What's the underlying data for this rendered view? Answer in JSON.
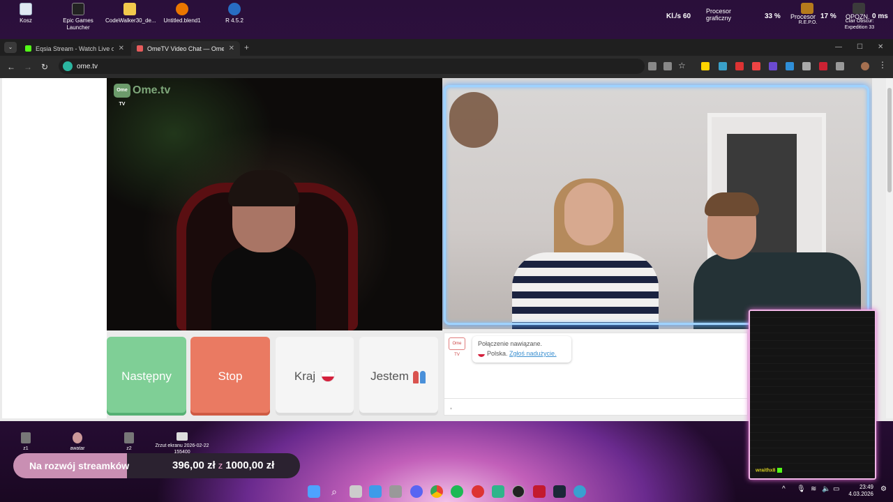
{
  "desktop": {
    "icons": [
      {
        "label": "Kosz",
        "icon": "recycle-bin-icon"
      },
      {
        "label": "Epic Games Launcher",
        "icon": "epic-games-icon"
      },
      {
        "label": "CodeWalker30_de...",
        "icon": "folder-icon"
      },
      {
        "label": "Untitled.blend1",
        "icon": "blender-icon"
      },
      {
        "label": "R 4.5.2",
        "icon": "r-lang-icon"
      }
    ],
    "bottom_icons": [
      {
        "label": "z1",
        "icon": "file-icon"
      },
      {
        "label": "awatar",
        "icon": "image-icon"
      },
      {
        "label": "z2",
        "icon": "file-icon"
      },
      {
        "label": "Zrzut ekranu 2026-02-22 155400",
        "icon": "screenshot-icon"
      }
    ]
  },
  "hud": {
    "fps_label": "Kl./s",
    "fps_value": "60",
    "gpu_label": "Procesor graficzny",
    "gpu_value": "33 %",
    "cpu_label": "Procesor",
    "cpu_value": "17 %",
    "latency_label": "OPÓŹN.",
    "latency_value": "0 ms",
    "app1": "R.E.P.O.",
    "app2": "Clair Obscur: Expedition 33"
  },
  "browser": {
    "tabs": [
      {
        "title": "Eqsia Stream - Watch Live on Ki",
        "active": false,
        "icon": "kick-icon"
      },
      {
        "title": "OmeTV Video Chat — Ome",
        "active": true,
        "icon": "ometv-icon"
      }
    ],
    "new_tab": "+",
    "url": "ome.tv"
  },
  "ometv": {
    "logo_box": "Ome TV",
    "logo_text": "Ome.tv",
    "buttons": {
      "next": "Następny",
      "stop": "Stop",
      "country": "Kraj",
      "gender": "Jestem"
    },
    "chat": {
      "avatar": "Ome TV",
      "line1": "Połączenie nawiązane.",
      "country": "Polska.",
      "report": "Zgłoś nadużycie.",
      "input": ","
    }
  },
  "overlay": {
    "cam_name": "wraithx8",
    "goal_label": "Na rozwój streamków",
    "goal_current": "396,00 zł",
    "goal_separator": "z",
    "goal_target": "1000,00 zł",
    "goal_progress": 0.396
  },
  "taskbar": {
    "time": "23:49",
    "date": "4.03.2026"
  },
  "colors": {
    "next": "#7fcf96",
    "stop": "#ea7a62",
    "accent_pink": "#f2b6e8"
  }
}
